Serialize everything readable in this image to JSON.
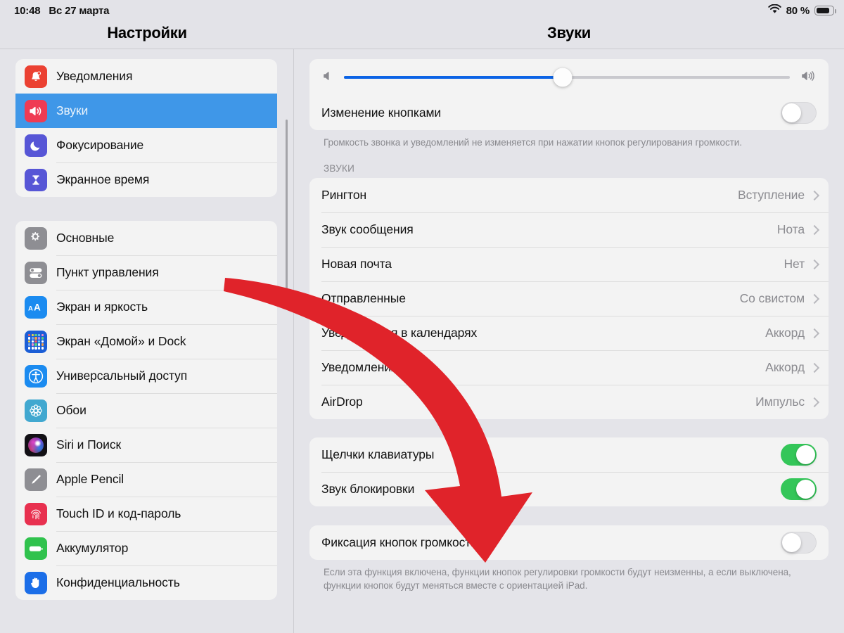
{
  "status_bar": {
    "time": "10:48",
    "date": "Вс 27 марта",
    "wifi_icon": "wifi-icon",
    "battery_percent": "80 %",
    "battery_level": 80
  },
  "nav": {
    "left_title": "Настройки",
    "right_title": "Звуки"
  },
  "sidebar": {
    "groups": [
      {
        "items": [
          {
            "label": "Уведомления",
            "icon": "bell-icon",
            "selected": false
          },
          {
            "label": "Звуки",
            "icon": "speaker-icon",
            "selected": true
          },
          {
            "label": "Фокусирование",
            "icon": "moon-icon",
            "selected": false
          },
          {
            "label": "Экранное время",
            "icon": "hourglass-icon",
            "selected": false
          }
        ]
      },
      {
        "items": [
          {
            "label": "Основные",
            "icon": "gear-icon",
            "selected": false
          },
          {
            "label": "Пункт управления",
            "icon": "switches-icon",
            "selected": false
          },
          {
            "label": "Экран и яркость",
            "icon": "aa-icon",
            "selected": false
          },
          {
            "label": "Экран «Домой» и Dock",
            "icon": "app-grid-icon",
            "selected": false
          },
          {
            "label": "Универсальный доступ",
            "icon": "accessibility-icon",
            "selected": false
          },
          {
            "label": "Обои",
            "icon": "flower-icon",
            "selected": false
          },
          {
            "label": "Siri и Поиск",
            "icon": "siri-icon",
            "selected": false
          },
          {
            "label": "Apple Pencil",
            "icon": "pencil-icon",
            "selected": false
          },
          {
            "label": "Touch ID и код-пароль",
            "icon": "fingerprint-icon",
            "selected": false
          },
          {
            "label": "Аккумулятор",
            "icon": "battery-icon",
            "selected": false
          },
          {
            "label": "Конфиденциальность",
            "icon": "hand-icon",
            "selected": false
          }
        ]
      }
    ]
  },
  "main": {
    "volume": {
      "left_icon": "speaker-low-icon",
      "right_icon": "speaker-high-icon",
      "value_percent": 49
    },
    "change_with_buttons": {
      "label": "Изменение кнопками",
      "enabled": false
    },
    "volume_footnote": "Громкость звонка и уведомлений не изменяется при нажатии кнопок регулирования громкости.",
    "sounds_section_title": "ЗВУКИ",
    "sound_rows": [
      {
        "label": "Рингтон",
        "value": "Вступление"
      },
      {
        "label": "Звук сообщения",
        "value": "Нота"
      },
      {
        "label": "Новая почта",
        "value": "Нет"
      },
      {
        "label": "Отправленные",
        "value": "Со свистом"
      },
      {
        "label": "Уведомления в календарях",
        "value": "Аккорд"
      },
      {
        "label": "Уведомления",
        "value": "Аккорд"
      },
      {
        "label": "AirDrop",
        "value": "Импульс"
      }
    ],
    "toggle_rows": [
      {
        "label": "Щелчки клавиатуры",
        "enabled": true
      },
      {
        "label": "Звук блокировки",
        "enabled": true
      }
    ],
    "lock_row": {
      "label": "Фиксация кнопок громкости",
      "enabled": false
    },
    "lock_footnote": "Если эта функция включена, функции кнопок регулировки громкости будут неизменны, а если выключена, функции кнопок будут меняться вместе с ориентацией iPad."
  },
  "annotation": {
    "arrow_icon": "curved-down-arrow-icon",
    "arrow_color": "#e0232a"
  },
  "colors": {
    "accent_blue": "#3f97e8",
    "slider_blue": "#0b63e5",
    "toggle_green": "#34c659",
    "panel_bg": "#e4e4e9",
    "card_bg": "#f3f3f3",
    "arrow_red": "#e0232a"
  }
}
